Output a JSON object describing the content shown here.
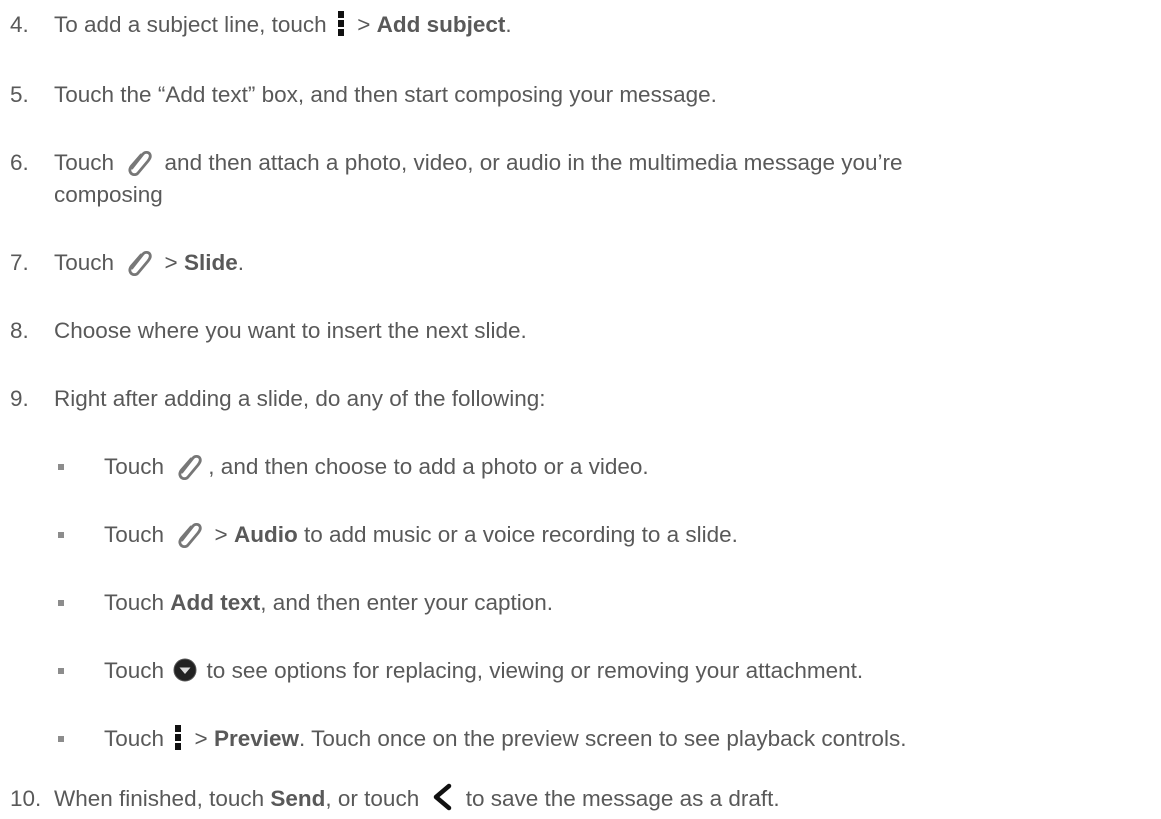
{
  "steps": [
    {
      "num": "4.",
      "parts": [
        "To add a subject line, touch ",
        " > ",
        "Add subject",
        "."
      ]
    },
    {
      "num": "5.",
      "text": "Touch the “Add text” box, and then start composing your message."
    },
    {
      "num": "6.",
      "parts": [
        "Touch ",
        " and then attach a photo, video, or audio in the multimedia message you’re"
      ],
      "cont": "composing"
    },
    {
      "num": "7.",
      "parts": [
        "Touch ",
        " > ",
        "Slide",
        "."
      ]
    },
    {
      "num": "8.",
      "text": "Choose where you want to insert the next slide."
    },
    {
      "num": "9.",
      "text": "Right after adding a slide, do any of the following:"
    },
    {
      "num": "10.",
      "parts": [
        "When finished, touch ",
        "Send",
        ", or touch ",
        " to save the message as a draft."
      ]
    }
  ],
  "bullets": [
    {
      "parts": [
        "Touch ",
        ", and then choose to add a photo or a video."
      ]
    },
    {
      "parts": [
        "Touch ",
        " > ",
        "Audio",
        " to add music or a voice recording to a slide."
      ]
    },
    {
      "parts": [
        "Touch ",
        "Add text",
        ", and then enter your caption."
      ]
    },
    {
      "parts": [
        "Touch ",
        " to see options for replacing, viewing or removing your attachment."
      ]
    },
    {
      "parts": [
        "Touch ",
        " > ",
        "Preview",
        ". Touch once on the preview screen to see playback controls."
      ]
    }
  ],
  "icons": {
    "menu": "menu-icon",
    "attach": "paperclip-icon",
    "options": "dropdown-circle-icon",
    "back": "back-chevron-icon"
  },
  "colors": {
    "text": "#595959",
    "bullet": "#8c8c8c",
    "icon": "#111111"
  }
}
